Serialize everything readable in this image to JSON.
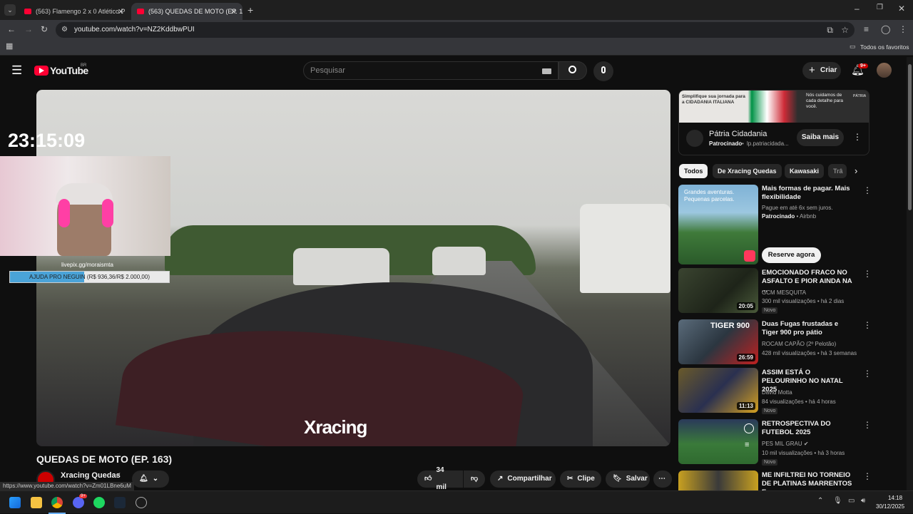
{
  "browser": {
    "tabs": [
      {
        "label": "(563) Flamengo 2 x 0 Atlético P"
      },
      {
        "label": "(563) QUEDAS DE MOTO (EP. 1"
      }
    ],
    "url": "youtube.com/watch?v=NZ2KddbwPUI",
    "bookmarks_label": "Todos os favoritos",
    "status_url": "https://www.youtube.com/watch?v=Zm01LBne6uM"
  },
  "header": {
    "logo": "YouTube",
    "region": "BR",
    "search_placeholder": "Pesquisar",
    "create_label": "Criar",
    "notif_badge": "9+"
  },
  "video": {
    "overlay_time": "23:15:09",
    "donate_link": "livepix.gg/moraismta",
    "donate_text": "AJUDA PRO NEGUIN (R$ 936,36/R$ 2.000,00)",
    "donate_progress": 0.468,
    "watermark": "Xracing",
    "title": "QUEDAS DE MOTO (EP. 163)",
    "channel": "Xracing Quedas",
    "likes": "34 mil",
    "share": "Compartilhar",
    "clip": "Clipe",
    "save": "Salvar"
  },
  "ad": {
    "banner_left": "Simplifique sua jornada para a CIDADANIA ITALIANA",
    "banner_right": "Nós cuidamos de cada detalhe para você.",
    "banner_brand": "PÁTRIA",
    "name": "Pátria Cidadania",
    "sponsored": "Patrocinado",
    "domain": "lp.patriacidada...",
    "cta": "Saiba mais"
  },
  "chips": [
    "Todos",
    "De Xracing Quedas",
    "Kawasaki",
    "Trâ"
  ],
  "related": [
    {
      "title": "Mais formas de pagar. Mais flexibilidade",
      "sub": "Pague em até 6x sem juros.",
      "sponsor": "Patrocinado",
      "brand": "Airbnb",
      "thumb_text": "Grandes aventuras. Pequenas parcelas.",
      "cta": "Reserve agora"
    },
    {
      "title": "EMOCIONADO FRACO NO ASFALTO E PIOR AINDA NA ...",
      "channel": "GCM MESQUITA",
      "meta": "300 mil visualizações • há 2 dias",
      "badge": "Novo",
      "duration": "20:05"
    },
    {
      "title": "Duas Fugas frustadas e Tiger 900 pro pátio",
      "channel": "ROCAM CAPÃO (2º Pelotão)",
      "meta": "428 mil visualizações • há 3 semanas",
      "duration": "26:59",
      "thumb_text": "TIGER 900"
    },
    {
      "title": "ASSIM ESTÁ O PELOURINHO NO NATAL 2025",
      "channel": "David Motta",
      "meta": "84 visualizações • há 4 horas",
      "badge": "Novo",
      "duration": "11:13"
    },
    {
      "title": "RETROSPECTIVA DO FUTEBOL 2025",
      "channel": "PES MIL GRAU",
      "meta": "10 mil visualizações • há 3 horas",
      "badge": "Novo"
    },
    {
      "title": "ME INFILTREI NO TORNEIO DE PLATINAS MARRENTOS E ..."
    }
  ],
  "taskbar": {
    "time": "14:18",
    "date": "30/12/2025",
    "discord_badge": "9+"
  }
}
